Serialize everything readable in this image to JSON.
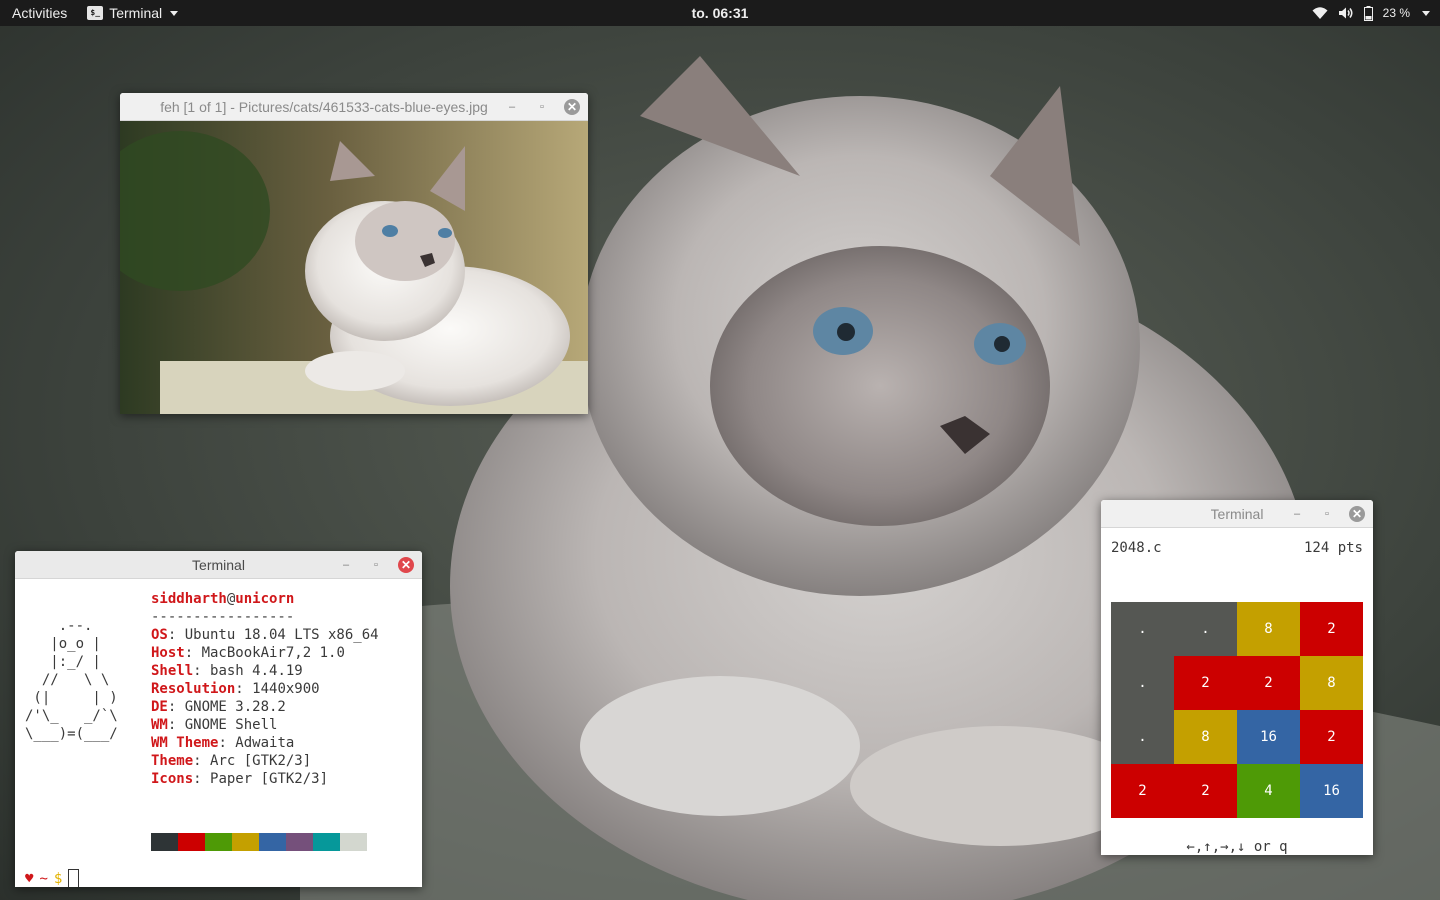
{
  "topbar": {
    "activities": "Activities",
    "app_name": "Terminal",
    "app_icon": "terminal-icon",
    "app_icon_glyph": "$_",
    "clock": "to. 06:31",
    "battery": "23 %",
    "icons": [
      "wifi-icon",
      "volume-icon",
      "battery-icon",
      "system-menu-caret-icon"
    ]
  },
  "feh_window": {
    "title": "feh [1 of 1] - Pictures/cats/461533-cats-blue-eyes.jpg",
    "controls": {
      "minimize": "–",
      "maximize": "▫",
      "close": "✕"
    }
  },
  "neofetch_window": {
    "title": "Terminal",
    "controls": {
      "minimize": "–",
      "maximize": "▫",
      "close": "✕"
    },
    "ascii": "    .--.\n   |o_o |\n   |:_/ |\n  //   \\ \\\n (|     | )\n/'\\_   _/`\\\n\\___)=(___/",
    "user": "siddharth",
    "at": "@",
    "host": "unicorn",
    "separator": "-----------------",
    "info": [
      {
        "key": "OS",
        "value": "Ubuntu 18.04 LTS x86_64"
      },
      {
        "key": "Host",
        "value": "MacBookAir7,2 1.0"
      },
      {
        "key": "Shell",
        "value": "bash 4.4.19"
      },
      {
        "key": "Resolution",
        "value": "1440x900"
      },
      {
        "key": "DE",
        "value": "GNOME 3.28.2"
      },
      {
        "key": "WM",
        "value": "GNOME Shell"
      },
      {
        "key": "WM Theme",
        "value": "Adwaita"
      },
      {
        "key": "Theme",
        "value": "Arc [GTK2/3]"
      },
      {
        "key": "Icons",
        "value": "Paper [GTK2/3]"
      }
    ],
    "palette": [
      "#2e3436",
      "#cc0000",
      "#4e9a06",
      "#c4a000",
      "#3465a4",
      "#75507b",
      "#06989a",
      "#d3d7cf"
    ],
    "prompt": {
      "heart": "♥",
      "tilde": "~",
      "dollar": "$"
    }
  },
  "game_window": {
    "title": "Terminal",
    "controls": {
      "minimize": "–",
      "maximize": "▫",
      "close": "✕"
    },
    "program": "2048.c",
    "score": "124 pts",
    "board": [
      [
        ".",
        ".",
        "8",
        "2"
      ],
      [
        ".",
        "2",
        "2",
        "8"
      ],
      [
        ".",
        "8",
        "16",
        "2"
      ],
      [
        "2",
        "2",
        "4",
        "16"
      ]
    ],
    "tile_colors": {
      ".": "#555753",
      "2": "#cc0000",
      "4": "#4e9a06",
      "8": "#c4a000",
      "16": "#3465a4"
    },
    "hint": "←,↑,→,↓ or q"
  }
}
